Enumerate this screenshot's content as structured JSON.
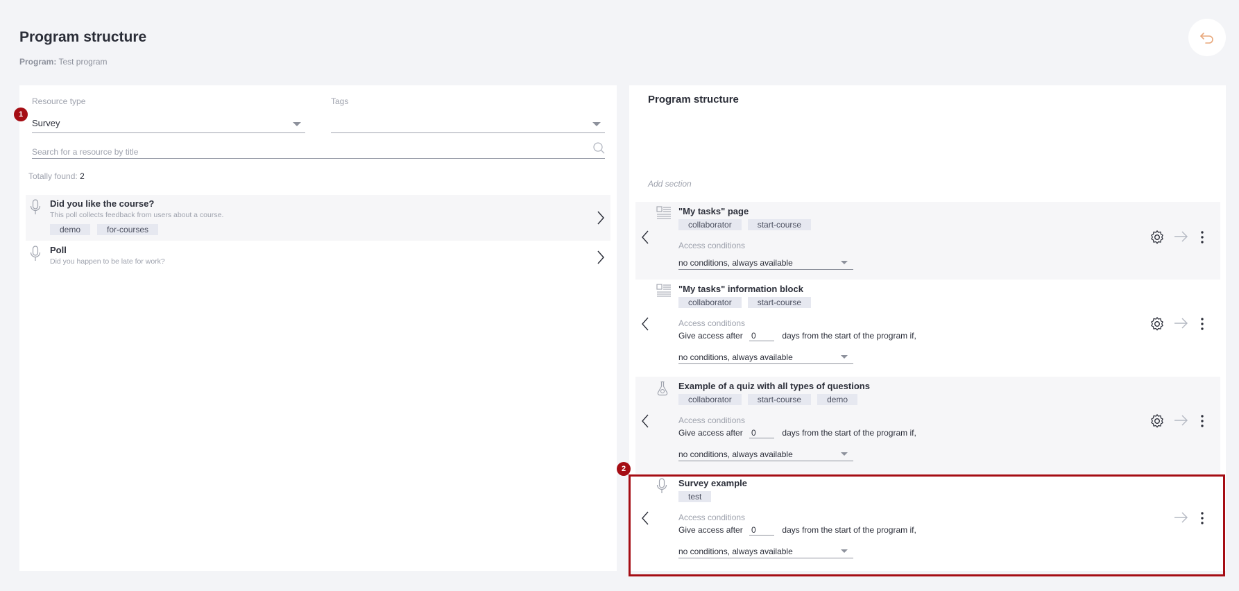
{
  "header": {
    "title": "Program structure",
    "program_label": "Program:",
    "program_name": "Test program"
  },
  "filters": {
    "resource_type_label": "Resource type",
    "resource_type_value": "Survey",
    "tags_label": "Tags",
    "tags_value": "",
    "search_placeholder": "Search for a resource by title",
    "found_label": "Totally found:",
    "found_count": "2"
  },
  "badges": {
    "one": "1",
    "two": "2"
  },
  "resources": [
    {
      "title": "Did you like the course?",
      "description": "This poll collects feedback from users about a course.",
      "tags": [
        "demo",
        "for-courses"
      ]
    },
    {
      "title": "Poll",
      "description": "Did you happen to be late for work?",
      "tags": []
    }
  ],
  "structure": {
    "title": "Program structure",
    "add_section": "Add section",
    "access_label": "Access conditions",
    "give_before": "Give access after",
    "give_after": "days from the start of the program if,",
    "cards": [
      {
        "title": "\"My tasks\" page",
        "tags": [
          "collaborator",
          "start-course"
        ],
        "days": "",
        "condition": "no conditions, always available"
      },
      {
        "title": "\"My tasks\" information block",
        "tags": [
          "collaborator",
          "start-course"
        ],
        "days": "0",
        "condition": "no conditions, always available"
      },
      {
        "title": "Example of a quiz with all types of questions",
        "tags": [
          "collaborator",
          "start-course",
          "demo"
        ],
        "days": "0",
        "condition": "no conditions, always available"
      },
      {
        "title": "Survey example",
        "tags": [
          "test"
        ],
        "days": "0",
        "condition": "no conditions, always available"
      }
    ]
  },
  "colors": {
    "accent_badge": "#a50d14",
    "tag_bg": "#e6e8f0",
    "back_icon": "#e8a77a"
  }
}
